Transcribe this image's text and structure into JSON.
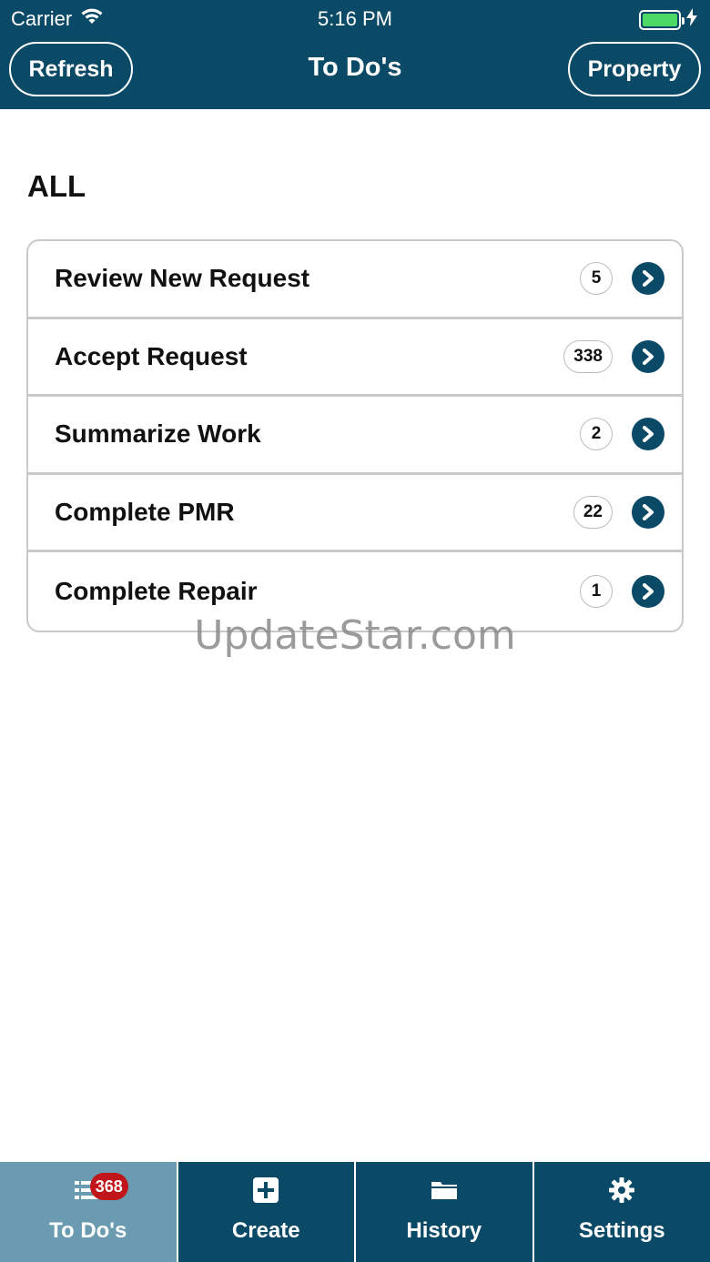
{
  "status_bar": {
    "carrier": "Carrier",
    "time": "5:16 PM"
  },
  "nav": {
    "title": "To Do's",
    "left_button": "Refresh",
    "right_button": "Property"
  },
  "section_title": "ALL",
  "items": [
    {
      "label": "Review New Request",
      "count": "5"
    },
    {
      "label": "Accept Request",
      "count": "338"
    },
    {
      "label": "Summarize Work",
      "count": "2"
    },
    {
      "label": "Complete PMR",
      "count": "22"
    },
    {
      "label": "Complete Repair",
      "count": "1"
    }
  ],
  "watermark": "UpdateStar.com",
  "tabs": [
    {
      "label": "To Do's",
      "icon": "list-icon",
      "badge": "368",
      "active": true
    },
    {
      "label": "Create",
      "icon": "plus-square-icon"
    },
    {
      "label": "History",
      "icon": "folder-icon"
    },
    {
      "label": "Settings",
      "icon": "gear-icon"
    }
  ],
  "colors": {
    "header_bg": "#0a4a66",
    "active_tab_bg": "#6a9bb0",
    "badge_red": "#c0161b",
    "battery_green": "#4cd964"
  }
}
